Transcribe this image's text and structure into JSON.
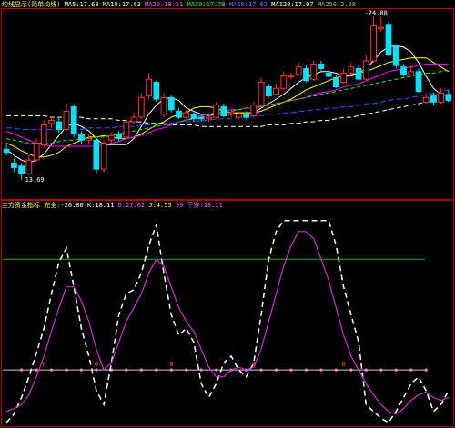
{
  "colors": {
    "background": "#000000",
    "frame": "#b00000",
    "up": "#ff3333",
    "down": "#00e0ff",
    "ma5": "#ffffff",
    "ma10": "#ffff00",
    "ma20": "#ff00ff",
    "ma30": "#00ff00",
    "ma60": "#2255ff",
    "ma120": "#ffffff",
    "k_line": "#ffffff",
    "d_line": "#cc33cc",
    "level_line": "#22aa22",
    "zero_line": "#cccccc"
  },
  "top_header": [
    {
      "text": "均线显示(简单均线)",
      "color": "#ffff55"
    },
    {
      "text": " MA5:17.68",
      "color": "#ffffff"
    },
    {
      "text": " MA10:17.63",
      "color": "#ffff00"
    },
    {
      "text": " MA20:18.51",
      "color": "#ff55ff"
    },
    {
      "text": " MA30:17.78",
      "color": "#00ff00"
    },
    {
      "text": " MA60:17.02",
      "color": "#5577ff"
    },
    {
      "text": " MA120:17.07",
      "color": "#ffffff"
    },
    {
      "text": " MA250:2.08",
      "color": "#aaaaaa"
    }
  ],
  "bottom_header": [
    {
      "text": "主力资金指标 完全:",
      "color": "#ffff55"
    },
    {
      "text": "-20.80",
      "color": "#ffffff"
    },
    {
      "text": "  K:18.11",
      "color": "#ffffff"
    },
    {
      "text": "  D:27.62",
      "color": "#ff55ff"
    },
    {
      "text": "  J:4.55",
      "color": "#ffff00"
    },
    {
      "text": "  99  下穿:18.11",
      "color": "#ff55ff"
    }
  ],
  "price_labels": {
    "high": "-24.88",
    "low": "13.69"
  },
  "chart_data": [
    {
      "type": "candlestick",
      "title": "",
      "ylim": [
        13,
        25.4
      ],
      "x": [
        1,
        2,
        3,
        4,
        5,
        6,
        7,
        8,
        9,
        10,
        11,
        12,
        13,
        14,
        15,
        16,
        17,
        18,
        19,
        20,
        21,
        22,
        23,
        24,
        25,
        26,
        27,
        28,
        29,
        30,
        31,
        32,
        33,
        34,
        35,
        36,
        37,
        38,
        39,
        40,
        41,
        42,
        43,
        44,
        45,
        46,
        47,
        48,
        49,
        50,
        51,
        52,
        53,
        54,
        55,
        56,
        57,
        58,
        59,
        60
      ],
      "open": [
        16.2,
        15.3,
        15.1,
        14.6,
        15.5,
        16.5,
        17.9,
        18.0,
        17.5,
        19.0,
        17.2,
        16.8,
        16.8,
        14.9,
        16.8,
        17.2,
        17.0,
        18.0,
        18.3,
        19.7,
        20.6,
        18.5,
        19.6,
        18.7,
        18.3,
        18.5,
        18.3,
        18.2,
        18.3,
        19.0,
        18.5,
        18.3,
        18.5,
        18.4,
        19.1,
        20.3,
        19.8,
        20.2,
        21.0,
        21.1,
        21.5,
        20.8,
        21.8,
        21.2,
        20.9,
        20.6,
        21.2,
        21.5,
        20.8,
        22.0,
        24.1,
        24.4,
        23.0,
        21.6,
        21.1,
        21.3,
        19.3,
        19.7,
        19.3,
        19.8
      ],
      "close": [
        16.0,
        15.0,
        14.6,
        15.5,
        16.6,
        17.8,
        18.1,
        17.5,
        18.7,
        17.2,
        16.8,
        16.9,
        14.9,
        16.6,
        17.1,
        16.9,
        18.0,
        18.3,
        19.6,
        20.8,
        19.5,
        19.6,
        18.8,
        18.3,
        18.6,
        18.2,
        18.2,
        18.3,
        19.1,
        18.4,
        18.6,
        18.5,
        18.3,
        19.1,
        20.6,
        19.7,
        20.2,
        21.0,
        21.0,
        21.6,
        20.7,
        21.8,
        21.5,
        21.0,
        20.3,
        21.2,
        21.6,
        20.8,
        22.0,
        24.3,
        24.2,
        22.4,
        21.7,
        21.1,
        21.3,
        20.0,
        19.6,
        19.3,
        19.9,
        19.4
      ],
      "high": [
        16.5,
        15.6,
        15.3,
        15.8,
        16.9,
        18.1,
        18.3,
        18.3,
        19.2,
        19.1,
        17.4,
        17.2,
        16.9,
        16.8,
        17.3,
        17.4,
        18.2,
        18.6,
        19.9,
        21.2,
        20.7,
        19.9,
        19.8,
        18.9,
        18.8,
        18.7,
        18.5,
        18.5,
        19.3,
        19.2,
        18.8,
        18.7,
        18.7,
        19.3,
        20.9,
        20.5,
        20.5,
        21.3,
        21.2,
        21.9,
        21.7,
        22.0,
        22.0,
        21.4,
        21.1,
        21.5,
        21.9,
        21.7,
        22.4,
        24.9,
        24.9,
        24.6,
        23.1,
        21.8,
        21.7,
        21.5,
        19.8,
        19.9,
        20.2,
        20.1
      ],
      "low": [
        15.8,
        14.7,
        14.2,
        14.5,
        15.4,
        16.3,
        17.6,
        17.3,
        17.3,
        17.0,
        16.5,
        16.5,
        14.6,
        14.7,
        16.6,
        16.7,
        16.9,
        17.9,
        18.2,
        19.5,
        19.3,
        18.3,
        18.6,
        18.2,
        18.1,
        18.0,
        18.0,
        18.0,
        18.2,
        18.3,
        18.3,
        18.2,
        18.2,
        18.3,
        19.0,
        19.6,
        19.7,
        20.1,
        20.8,
        21.0,
        20.6,
        20.7,
        21.3,
        20.9,
        20.2,
        20.5,
        21.1,
        20.7,
        20.7,
        21.9,
        23.9,
        22.3,
        21.5,
        21.0,
        21.0,
        19.9,
        19.2,
        19.1,
        19.2,
        19.3
      ],
      "ma_series": [
        {
          "name": "MA5",
          "values": [
            16.2,
            15.8,
            15.5,
            15.3,
            15.5,
            15.9,
            16.5,
            17.1,
            17.7,
            17.9,
            17.7,
            17.4,
            16.9,
            16.5,
            16.5,
            16.5,
            16.5,
            16.9,
            17.7,
            18.5,
            19.1,
            19.5,
            19.6,
            19.4,
            18.9,
            18.7,
            18.5,
            18.4,
            18.5,
            18.5,
            18.5,
            18.6,
            18.6,
            18.6,
            18.9,
            19.2,
            19.5,
            19.8,
            20.2,
            20.6,
            20.9,
            21.1,
            21.3,
            21.3,
            21.2,
            21.0,
            21.0,
            21.2,
            21.5,
            22.0,
            22.6,
            22.9,
            23.0,
            22.9,
            22.6,
            21.9,
            21.0,
            20.2,
            19.8,
            19.7
          ]
        },
        {
          "name": "MA10",
          "values": [
            16.6,
            16.4,
            16.1,
            15.9,
            15.7,
            15.7,
            15.8,
            16.0,
            16.4,
            16.6,
            16.8,
            17.0,
            17.0,
            17.1,
            17.0,
            16.9,
            16.9,
            17.0,
            17.2,
            17.5,
            17.8,
            18.0,
            18.3,
            18.5,
            18.6,
            18.9,
            19.0,
            19.0,
            18.9,
            18.7,
            18.6,
            18.6,
            18.6,
            18.6,
            18.7,
            18.9,
            19.1,
            19.3,
            19.5,
            19.8,
            20.1,
            20.3,
            20.5,
            20.7,
            20.9,
            21.0,
            21.1,
            21.2,
            21.3,
            21.5,
            21.7,
            21.9,
            22.0,
            22.1,
            22.2,
            22.2,
            22.2,
            21.9,
            21.6,
            21.3
          ]
        },
        {
          "name": "MA20",
          "values": [
            17.4,
            17.2,
            17.0,
            16.8,
            16.6,
            16.5,
            16.4,
            16.4,
            16.4,
            16.4,
            16.4,
            16.4,
            16.4,
            16.5,
            16.6,
            16.7,
            16.9,
            17.0,
            17.1,
            17.3,
            17.5,
            17.6,
            17.8,
            18.0,
            18.1,
            18.3,
            18.4,
            18.5,
            18.6,
            18.7,
            18.8,
            18.8,
            18.9,
            18.9,
            19.0,
            19.1,
            19.2,
            19.3,
            19.4,
            19.5,
            19.6,
            19.8,
            19.9,
            20.0,
            20.1,
            20.3,
            20.4,
            20.5,
            20.7,
            20.9,
            21.1,
            21.3,
            21.4,
            21.5,
            21.6,
            21.7,
            21.8,
            21.8,
            21.8,
            21.8
          ]
        },
        {
          "name": "MA30",
          "values": [
            16.9,
            16.8,
            16.7,
            16.6,
            16.6,
            16.6,
            16.6,
            16.7,
            16.8,
            16.8,
            16.9,
            16.9,
            17.0,
            17.0,
            17.1,
            17.2,
            17.3,
            17.4,
            17.5,
            17.6,
            17.7,
            17.8,
            17.9,
            18.0,
            18.1,
            18.2,
            18.3,
            18.4,
            18.5,
            18.6,
            18.7,
            18.8,
            18.9,
            19.0,
            19.0,
            19.1,
            19.2,
            19.3,
            19.4,
            19.5,
            19.6,
            19.7,
            19.8,
            19.9,
            20.0,
            20.1,
            20.2,
            20.3,
            20.4,
            20.5,
            20.6,
            20.7,
            20.8,
            20.9,
            21.0,
            21.1,
            21.2,
            21.2,
            21.3,
            21.4
          ]
        },
        {
          "name": "MA60",
          "values": [
            17.6,
            17.6,
            17.5,
            17.5,
            17.5,
            17.5,
            17.5,
            17.5,
            17.5,
            17.5,
            17.5,
            17.6,
            17.6,
            17.6,
            17.6,
            17.7,
            17.7,
            17.7,
            17.8,
            17.8,
            17.9,
            17.9,
            17.9,
            18.0,
            18.0,
            18.0,
            18.1,
            18.1,
            18.2,
            18.2,
            18.2,
            18.3,
            18.3,
            18.4,
            18.4,
            18.5,
            18.5,
            18.6,
            18.6,
            18.7,
            18.7,
            18.8,
            18.8,
            18.9,
            18.9,
            19.0,
            19.0,
            19.1,
            19.2,
            19.2,
            19.3,
            19.4,
            19.5,
            19.5,
            19.6,
            19.7,
            19.8,
            19.9,
            20.0,
            20.1
          ]
        },
        {
          "name": "MA120",
          "values": [
            18.4,
            18.4,
            18.4,
            18.4,
            18.4,
            18.4,
            18.3,
            18.3,
            18.3,
            18.3,
            18.3,
            18.2,
            18.2,
            18.2,
            18.2,
            18.1,
            18.1,
            18.0,
            18.0,
            17.9,
            17.9,
            17.9,
            17.8,
            17.8,
            17.8,
            17.8,
            17.7,
            17.7,
            17.7,
            17.7,
            17.7,
            17.7,
            17.7,
            17.7,
            17.7,
            17.8,
            17.8,
            17.8,
            17.9,
            17.9,
            18.0,
            18.0,
            18.1,
            18.1,
            18.2,
            18.3,
            18.3,
            18.4,
            18.5,
            18.6,
            18.7,
            18.8,
            18.9,
            19.0,
            19.1,
            19.2,
            19.3,
            19.4,
            19.5,
            19.6
          ]
        }
      ]
    },
    {
      "type": "line",
      "title": "",
      "ylim": [
        -40,
        115
      ],
      "levels": {
        "upper": 80,
        "zero": 0
      },
      "x": [
        1,
        2,
        3,
        4,
        5,
        6,
        7,
        8,
        9,
        10,
        11,
        12,
        13,
        14,
        15,
        16,
        17,
        18,
        19,
        20,
        21,
        22,
        23,
        24,
        25,
        26,
        27,
        28,
        29,
        30,
        31,
        32,
        33,
        34,
        35,
        36,
        37,
        38,
        39,
        40,
        41,
        42,
        43,
        44,
        45,
        46,
        47,
        48,
        49,
        50,
        51,
        52,
        53,
        54,
        55,
        56,
        57,
        58,
        59,
        60
      ],
      "series": [
        {
          "name": "K",
          "values": [
            -38,
            -32,
            -20,
            -5,
            12,
            30,
            55,
            78,
            88,
            60,
            30,
            10,
            -15,
            -25,
            5,
            40,
            55,
            58,
            70,
            90,
            105,
            70,
            40,
            25,
            30,
            20,
            -10,
            -20,
            -10,
            5,
            10,
            0,
            -5,
            5,
            40,
            80,
            100,
            108,
            108,
            108,
            108,
            108,
            108,
            108,
            90,
            60,
            40,
            20,
            -25,
            -30,
            -35,
            -38,
            -30,
            -20,
            -10,
            -5,
            -15,
            -30,
            -25,
            -15
          ]
        },
        {
          "name": "D",
          "values": [
            -30,
            -28,
            -25,
            -18,
            -5,
            10,
            28,
            45,
            60,
            60,
            50,
            35,
            15,
            0,
            5,
            20,
            35,
            45,
            55,
            70,
            80,
            75,
            60,
            45,
            35,
            28,
            15,
            2,
            -5,
            -5,
            0,
            2,
            0,
            2,
            15,
            35,
            55,
            75,
            90,
            100,
            100,
            95,
            80,
            65,
            45,
            25,
            10,
            0,
            -10,
            -18,
            -25,
            -30,
            -32,
            -28,
            -22,
            -18,
            -16,
            -20,
            -22,
            -20
          ]
        }
      ],
      "markers": [
        "0",
        "0",
        "0",
        "0",
        "0"
      ]
    }
  ]
}
